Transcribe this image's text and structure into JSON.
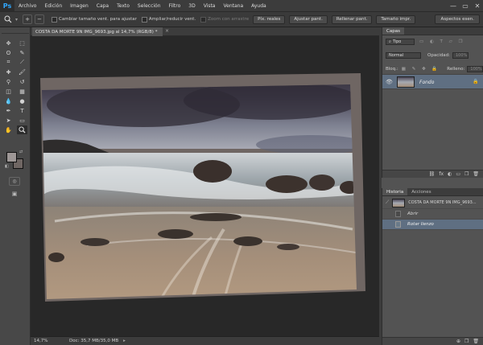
{
  "app": {
    "logo": "Ps"
  },
  "menu": [
    "Archivo",
    "Edición",
    "Imagen",
    "Capa",
    "Texto",
    "Selección",
    "Filtro",
    "3D",
    "Vista",
    "Ventana",
    "Ayuda"
  ],
  "window_controls": {
    "minimize": "—",
    "restore": "▭",
    "close": "✕"
  },
  "options": {
    "tool_icon": "zoom-icon",
    "zoom_in": "+",
    "zoom_out": "−",
    "resize_windows": "Cambiar tamaño vent. para ajustar",
    "zoom_all": "Ampliar/reducir vent.",
    "scrubby_zoom": "Zoom con arrastre",
    "actual_pixels": "Píx. reales",
    "fit_screen": "Ajustar pant.",
    "fill_screen": "Rellenar pant.",
    "print_size": "Tamaño impr.",
    "workspace": "Aspectos esen."
  },
  "document": {
    "tab_title": "COSTA DA MORTE 9N IMG_9693.jpg al 14,7% (RGB/8) *",
    "close": "×"
  },
  "status": {
    "zoom": "14,7%",
    "doc_info": "Doc: 35,7 MB/35,0 MB",
    "arrow": "▸"
  },
  "colors": {
    "foreground": "#9e9796",
    "background": "#6f6663",
    "accent": "#31a8ff"
  },
  "layers_panel": {
    "tab": "Capas",
    "kind_label": "Tipo",
    "blend_mode": "Normal",
    "opacity_label": "Opacidad:",
    "opacity_value": "100%",
    "lock_label": "Bloq.:",
    "fill_label": "Relleno:",
    "fill_value": "100%",
    "layer_name": "Fondo",
    "footer_icons": [
      "⊖",
      "fx",
      "◐",
      "▭",
      "❐",
      "🗑"
    ]
  },
  "history_panel": {
    "tabs": [
      "Historia",
      "Acciones"
    ],
    "snapshot": "COSTA DA MORTE 9N IMG_9693...",
    "steps": [
      "Abrir",
      "Rotar lienzo"
    ],
    "footer_icons": [
      "⊕",
      "❐",
      "🗑"
    ]
  },
  "tools": [
    "move",
    "marquee",
    "lasso",
    "quick-select",
    "crop",
    "eyedropper",
    "healing",
    "brush",
    "stamp",
    "history-brush",
    "eraser",
    "gradient",
    "blur",
    "dodge",
    "pen",
    "type",
    "path-select",
    "shape",
    "hand",
    "zoom"
  ]
}
